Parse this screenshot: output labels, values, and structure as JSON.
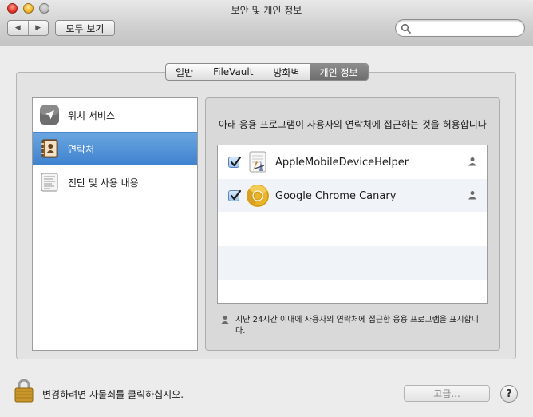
{
  "window": {
    "title": "보안 및 개인 정보",
    "show_all_label": "모두 보기",
    "back_glyph": "◀",
    "forward_glyph": "▶",
    "search_placeholder": ""
  },
  "tabs": [
    {
      "label": "일반",
      "active": false
    },
    {
      "label": "FileVault",
      "active": false
    },
    {
      "label": "방화벽",
      "active": false
    },
    {
      "label": "개인 정보",
      "active": true
    }
  ],
  "sidebar": {
    "items": [
      {
        "label": "위치 서비스",
        "icon": "location-arrow-icon",
        "selected": false
      },
      {
        "label": "연락처",
        "icon": "contacts-book-icon",
        "selected": true
      },
      {
        "label": "진단 및 사용 내용",
        "icon": "diagnostics-report-icon",
        "selected": false
      }
    ]
  },
  "main": {
    "heading": "아래 응용 프로그램이 사용자의 연락처에 접근하는 것을 허용합니다",
    "apps": [
      {
        "name": "AppleMobileDeviceHelper",
        "checked": true,
        "icon": "app-helper-icon"
      },
      {
        "name": "Google Chrome Canary",
        "checked": true,
        "icon": "chrome-canary-icon"
      }
    ],
    "note": "지난 24시간 이내에 사용자의 연락처에 접근한 응용 프로그램을 표시합니다."
  },
  "footer": {
    "lock_text": "변경하려면 자물쇠를 클릭하십시오.",
    "advanced_label": "고급...",
    "help_label": "?"
  },
  "colors": {
    "selection": "#3f82cf",
    "active_tab": "#7a7a7a"
  }
}
